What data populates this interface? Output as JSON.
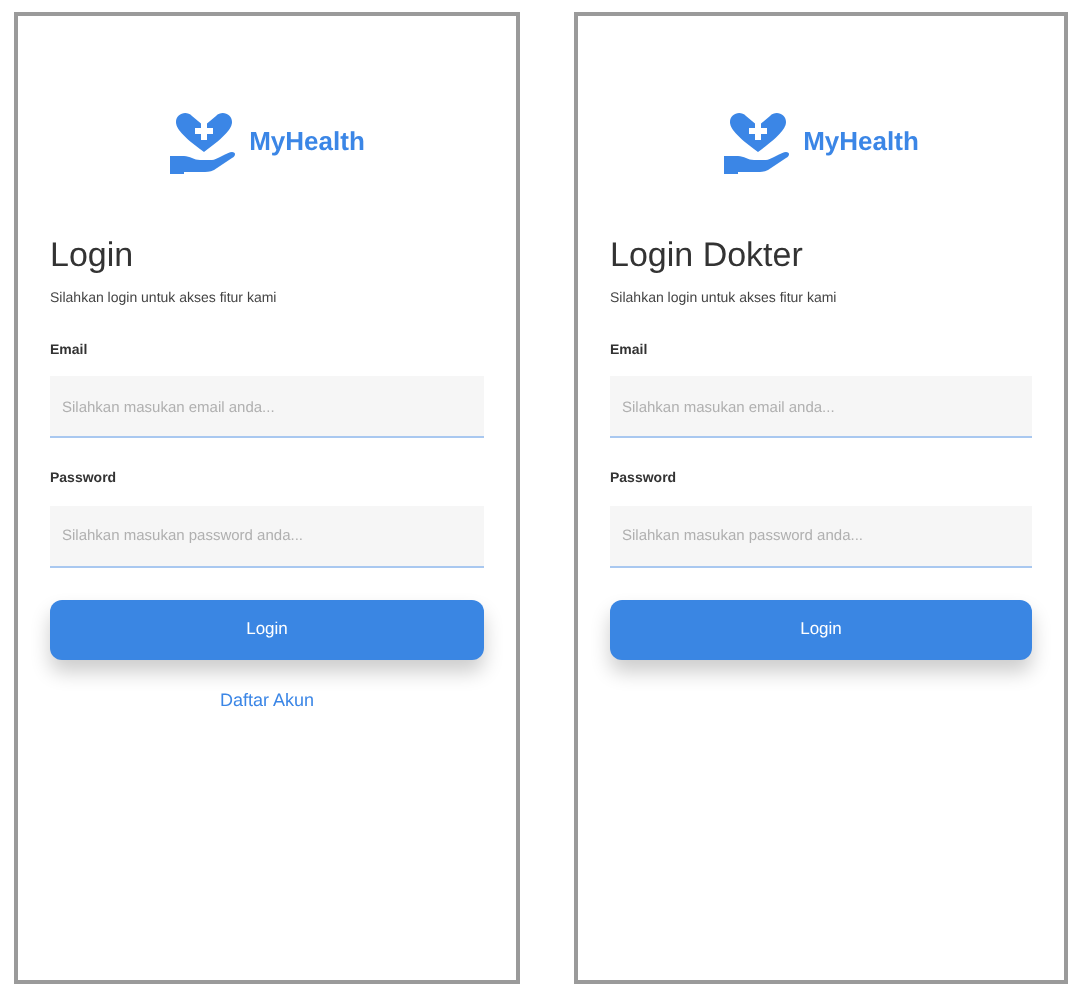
{
  "screens": [
    {
      "brand": "MyHealth",
      "title": "Login",
      "subtitle": "Silahkan login untuk akses fitur kami",
      "fields": [
        {
          "label": "Email",
          "placeholder": "Silahkan masukan email anda..."
        },
        {
          "label": "Password",
          "placeholder": "Silahkan masukan password anda..."
        }
      ],
      "button": "Login",
      "link": "Daftar Akun"
    },
    {
      "brand": "MyHealth",
      "title": "Login Dokter",
      "subtitle": "Silahkan login untuk akses fitur kami",
      "fields": [
        {
          "label": "Email",
          "placeholder": "Silahkan masukan email anda..."
        },
        {
          "label": "Password",
          "placeholder": "Silahkan masukan password anda..."
        }
      ],
      "button": "Login"
    }
  ]
}
